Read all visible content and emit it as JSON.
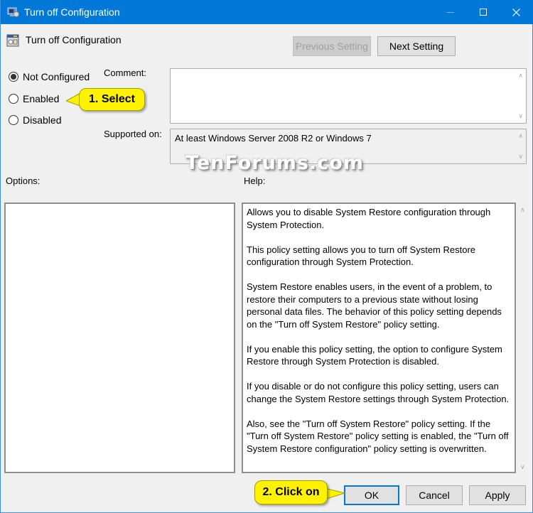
{
  "window": {
    "title": "Turn off Configuration",
    "controls": {
      "minimize": "minimize-icon",
      "maximize": "maximize-icon",
      "close": "close-icon"
    }
  },
  "header": {
    "policy_name": "Turn off Configuration",
    "previous_setting": "Previous Setting",
    "next_setting": "Next Setting"
  },
  "state": {
    "options": [
      {
        "label": "Not Configured",
        "selected": true
      },
      {
        "label": "Enabled",
        "selected": false
      },
      {
        "label": "Disabled",
        "selected": false
      }
    ]
  },
  "comment": {
    "label": "Comment:",
    "value": ""
  },
  "supported_on": {
    "label": "Supported on:",
    "value": "At least Windows Server 2008 R2 or Windows 7"
  },
  "sections": {
    "options_label": "Options:",
    "help_label": "Help:"
  },
  "help": {
    "paragraphs": [
      "Allows you to disable System Restore configuration through System Protection.",
      "This policy setting allows you to turn off System Restore configuration through System Protection.",
      "System Restore enables users, in the event of a problem, to restore their computers to a previous state without losing personal data files. The behavior of this policy setting depends on the \"Turn off System Restore\" policy setting.",
      "If you enable this policy setting, the option to configure System Restore through System Protection is disabled.",
      "If you disable or do not configure this policy setting, users can change the System Restore settings through System Protection.",
      "Also, see the \"Turn off System Restore\" policy setting. If the \"Turn off System Restore\" policy setting is enabled, the \"Turn off System Restore configuration\" policy setting is overwritten."
    ]
  },
  "footer": {
    "ok": "OK",
    "cancel": "Cancel",
    "apply": "Apply"
  },
  "annotations": {
    "step1": "1. Select",
    "step2": "2. Click on",
    "watermark": "TenForums.com",
    "callout_color": "#fff200"
  }
}
